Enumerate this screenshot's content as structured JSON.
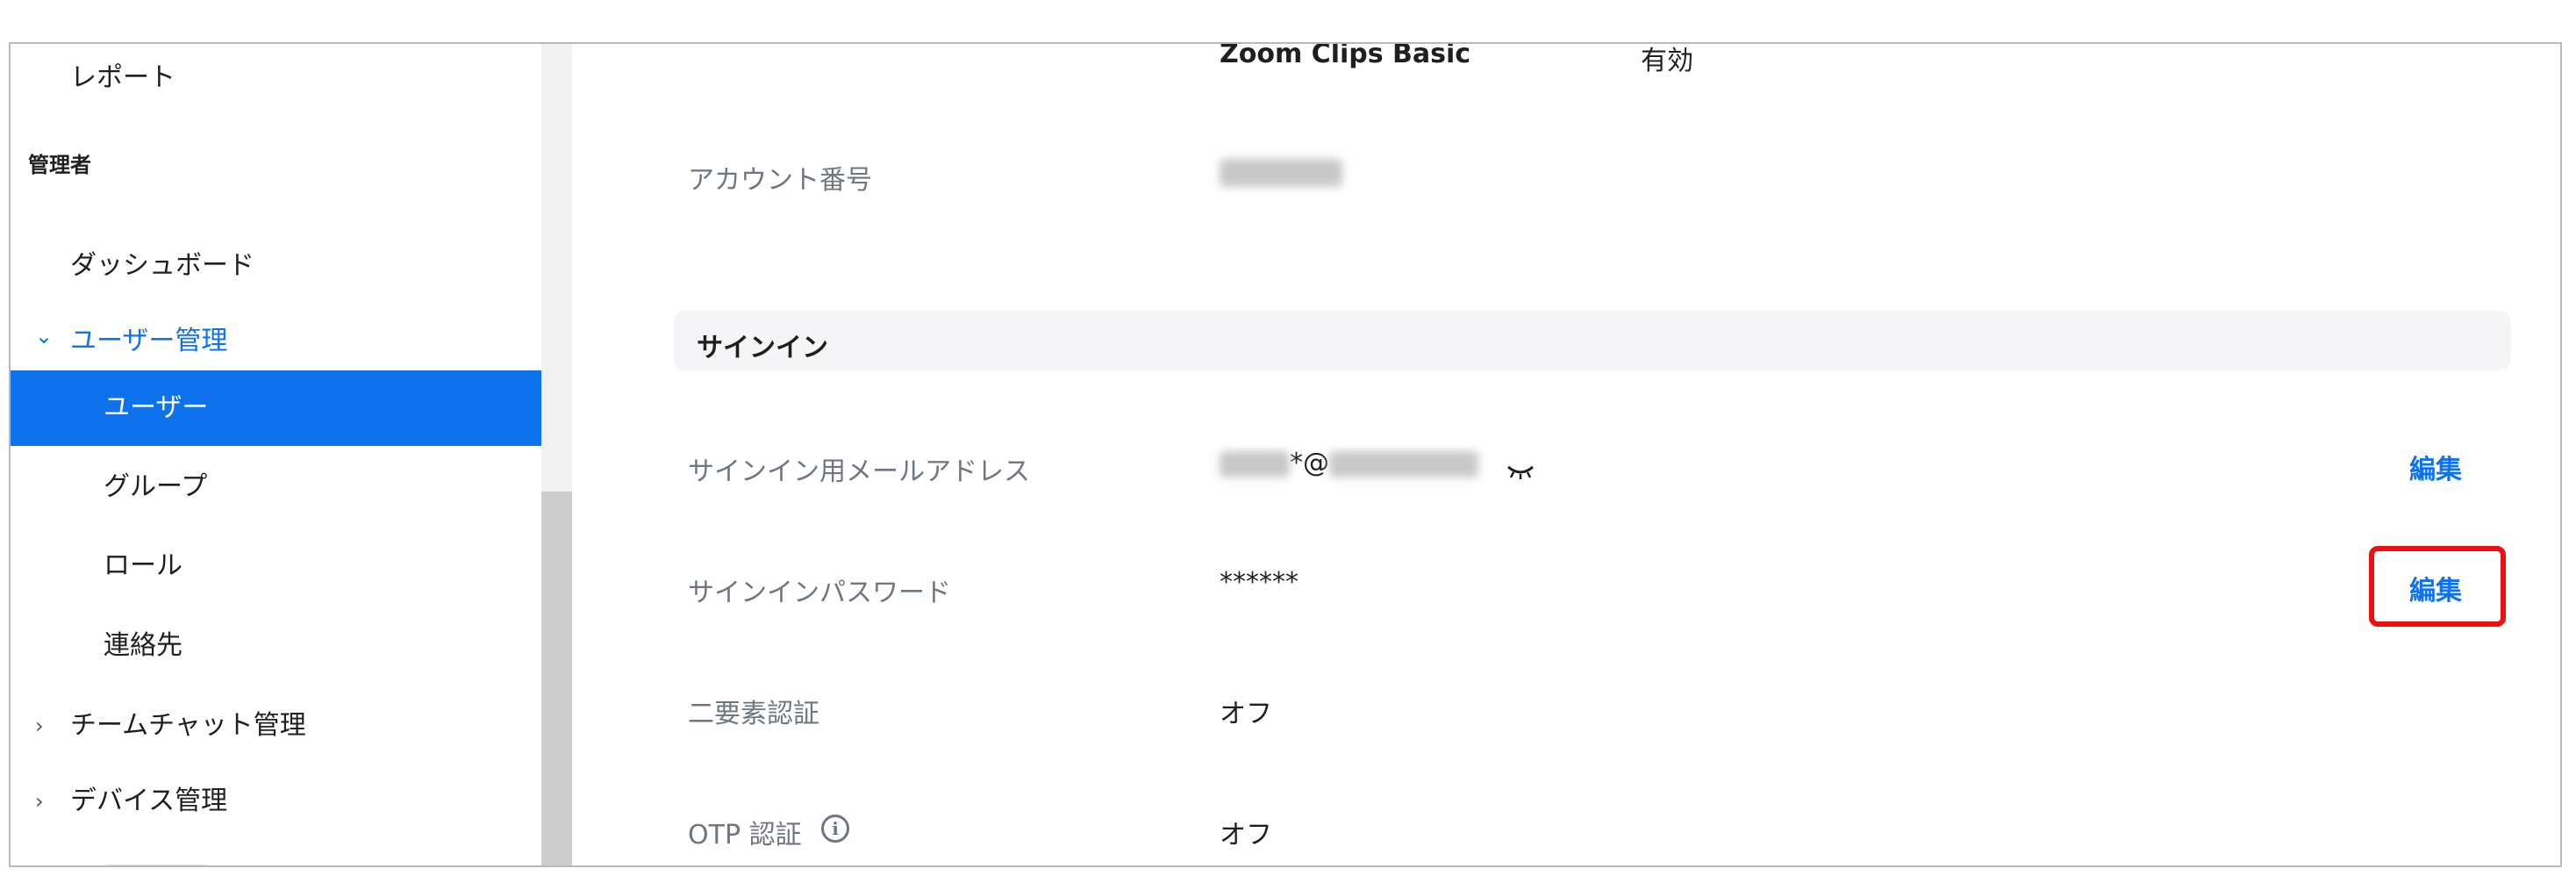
{
  "sidebar": {
    "report_label": "レポート",
    "admin_section": "管理者",
    "items": [
      {
        "label": "ダッシュボード"
      },
      {
        "label": "ユーザー管理",
        "chevron": "⌄"
      },
      {
        "label": "ユーザー"
      },
      {
        "label": "グループ"
      },
      {
        "label": "ロール"
      },
      {
        "label": "連絡先"
      },
      {
        "label": "チームチャット管理",
        "chevron": "›"
      },
      {
        "label": "デバイス管理",
        "chevron": "›"
      }
    ]
  },
  "main": {
    "plan": {
      "name": "Zoom Clips Basic",
      "status": "有効"
    },
    "account_number": {
      "label": "アカウント番号"
    },
    "signin_section": {
      "title": "サインイン"
    },
    "rows": [
      {
        "label": "サインイン用メールアドレス",
        "value_visible": "*@",
        "edit": "編集"
      },
      {
        "label": "サインインパスワード",
        "value": "******",
        "edit": "編集"
      },
      {
        "label": "二要素認証",
        "value": "オフ"
      },
      {
        "label": "OTP 認証",
        "value": "オフ"
      }
    ],
    "info_icon_glyph": "i"
  },
  "colors": {
    "accent": "#0e72ed",
    "highlight": "#ee0f0f",
    "label_gray": "#6e7680"
  }
}
